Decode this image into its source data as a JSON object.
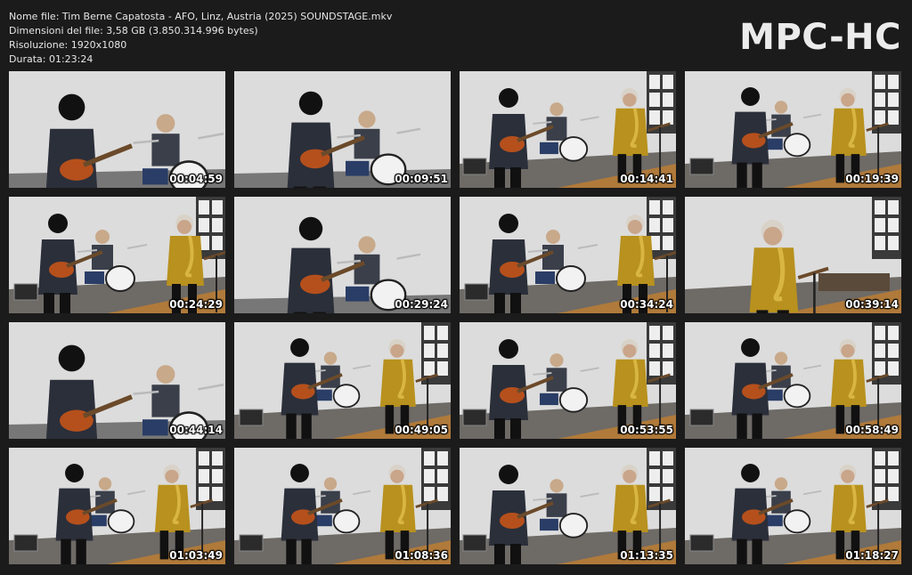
{
  "file_info": {
    "name": "Nome file: Tim Berne Capatosta - AFO, Linz, Austria (2025) SOUNDSTAGE.mkv",
    "size": "Dimensioni del file: 3,58 GB (3.850.314.996 bytes)",
    "resolution": "Risoluzione: 1920x1080",
    "duration": "Durata: 01:23:24"
  },
  "logo": "MPC-HC",
  "thumbnails": [
    {
      "timestamp": "00:04:59",
      "scene": "guitar-close"
    },
    {
      "timestamp": "00:09:51",
      "scene": "guitar-drums"
    },
    {
      "timestamp": "00:14:41",
      "scene": "wide-back"
    },
    {
      "timestamp": "00:19:39",
      "scene": "wide"
    },
    {
      "timestamp": "00:24:29",
      "scene": "trio-mid"
    },
    {
      "timestamp": "00:29:24",
      "scene": "guitar-drums"
    },
    {
      "timestamp": "00:34:24",
      "scene": "trio-mid"
    },
    {
      "timestamp": "00:39:14",
      "scene": "sax-close"
    },
    {
      "timestamp": "00:44:14",
      "scene": "guitar-close"
    },
    {
      "timestamp": "00:49:05",
      "scene": "wide"
    },
    {
      "timestamp": "00:53:55",
      "scene": "wide-back"
    },
    {
      "timestamp": "00:58:49",
      "scene": "wide"
    },
    {
      "timestamp": "01:03:49",
      "scene": "wide"
    },
    {
      "timestamp": "01:08:36",
      "scene": "wide"
    },
    {
      "timestamp": "01:13:35",
      "scene": "wide-back"
    },
    {
      "timestamp": "01:18:27",
      "scene": "wide"
    }
  ]
}
